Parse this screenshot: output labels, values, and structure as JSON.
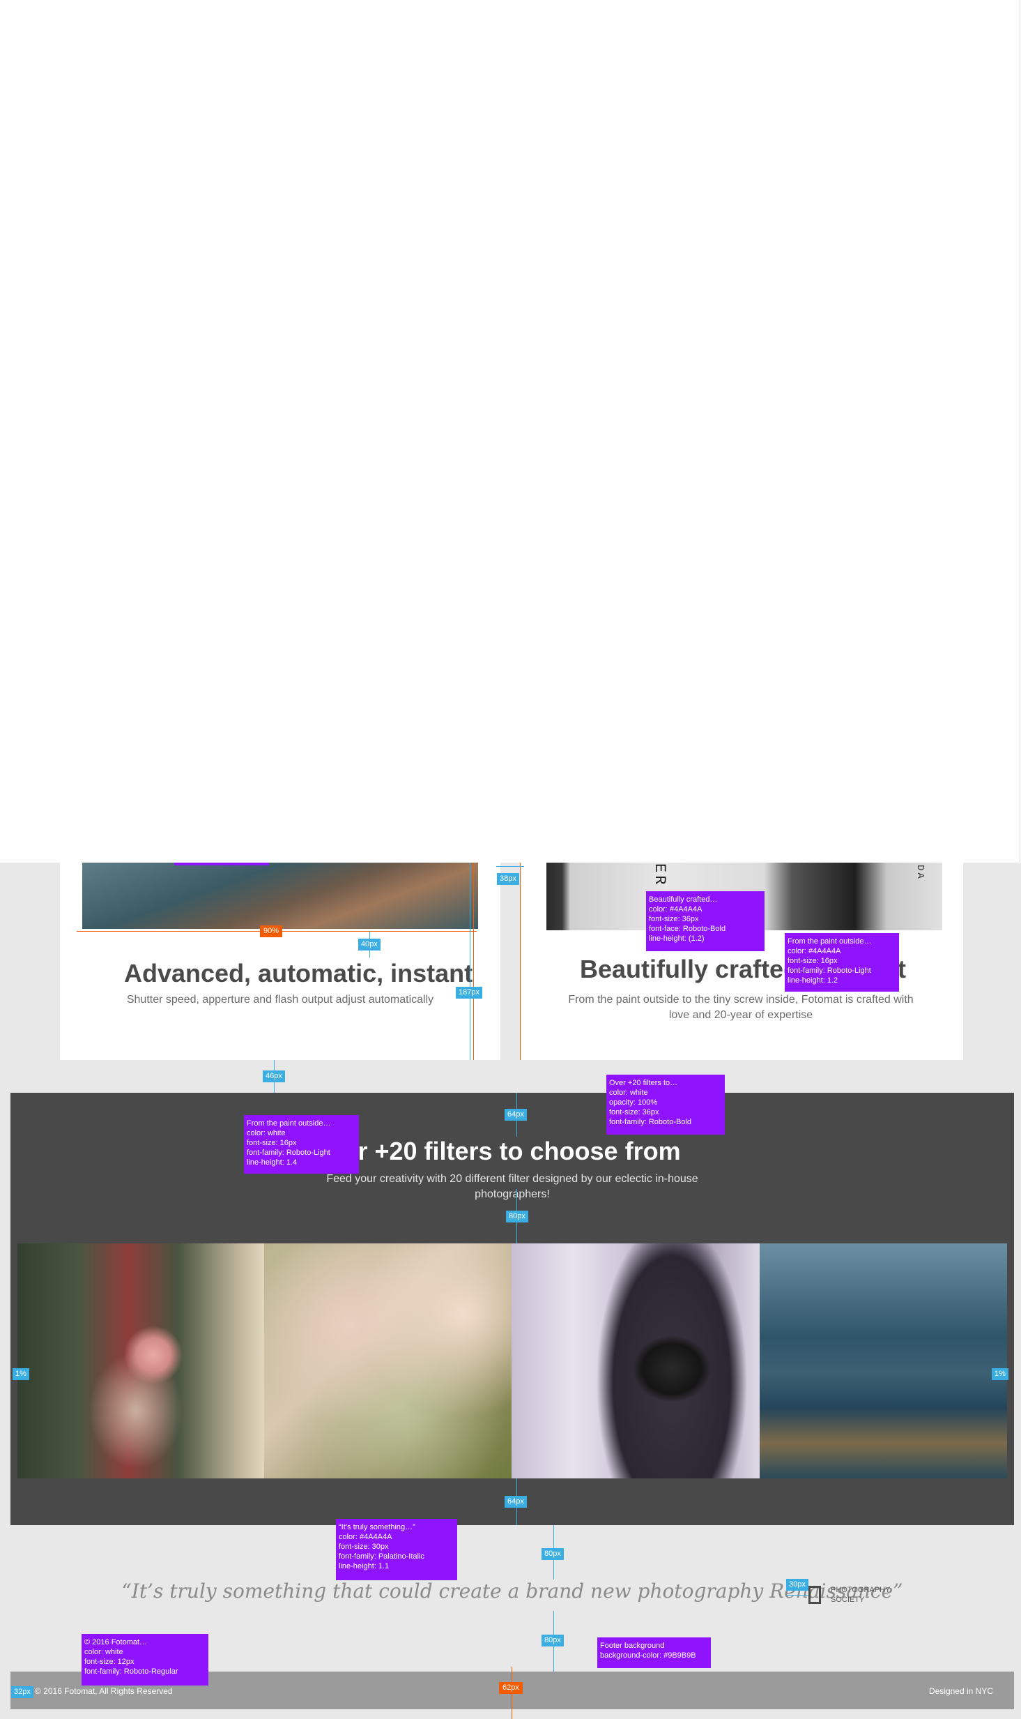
{
  "cards": {
    "left": {
      "title": "Advanced, automatic, instant",
      "body": "Shutter speed, apperture and flash output adjust automatically"
    },
    "right": {
      "title": "Beautifully crafted",
      "title_tail": "t",
      "body": "From the paint outside to the tiny screw inside, Fotomat is crafted with love and 20-year of expertise",
      "image_letters": "ER",
      "image_letters_small": "DA"
    }
  },
  "filters": {
    "title": "er +20 filters to choose from",
    "subtitle": "Feed your creativity with 20 different filter designed by our eclectic in-house photographers!",
    "photos": [
      {
        "name": "person-holding-rose"
      },
      {
        "name": "cherry-blossoms"
      },
      {
        "name": "person-holding-camera"
      },
      {
        "name": "mountain-valley"
      }
    ]
  },
  "quote": {
    "text": "“It’s truly something that could create a brand new photography Renaissance”",
    "logo_line1": "PHOTOGRAPHY",
    "logo_line2": "SOCIETY"
  },
  "footer": {
    "copyright": "© 2016  Fotomat, All Rights Reserved",
    "credit": "Designed in NYC",
    "background_color": "#9B9B9B"
  },
  "annotations": {
    "spacing": {
      "s38": "38px",
      "s40": "40px",
      "s187": "187px",
      "s46": "46px",
      "s64a": "64px",
      "s80a": "80px",
      "s1a": "1%",
      "s1b": "1%",
      "s64b": "64px",
      "s80b": "80px",
      "s30": "30px",
      "s80c": "80px",
      "s32": "32px",
      "s62": "62px",
      "s90": "90%"
    },
    "notes": {
      "beautifully": [
        "Beautifully crafted…",
        "color: #4A4A4A",
        "font-size: 36px",
        "font-face: Roboto-Bold",
        "line-height: (1.2)"
      ],
      "paint_right": [
        "From the paint outside…",
        "color: #4A4A4A",
        "font-size: 16px",
        "font-family: Roboto-Light",
        "line-height: 1.2"
      ],
      "over20": [
        "Over +20 filters to…",
        "color: white",
        "opacity: 100%",
        "font-size: 36px",
        "font-family: Roboto-Bold"
      ],
      "paint_left": [
        "From the paint outside…",
        "color: white",
        "font-size: 16px",
        "font-family: Roboto-Light",
        "line-height: 1.4"
      ],
      "quote": [
        "“It’s truly something…”",
        "color: #4A4A4A",
        "font-size: 30px",
        "font-family: Palatino-Italic",
        "line-height: 1.1"
      ],
      "copyright": [
        "© 2016 Fotomat…",
        "color: white",
        "font-size: 12px",
        "font-family: Roboto-Regular"
      ],
      "footer_bg": [
        "Footer background",
        "background-color: #9B9B9B"
      ]
    }
  },
  "colors": {
    "annotation_blue": "#3aaee3",
    "annotation_orange": "#f25c05",
    "annotation_purple": "#9013FE",
    "dark_section": "#494949",
    "page_gray": "#e8e8e8"
  }
}
